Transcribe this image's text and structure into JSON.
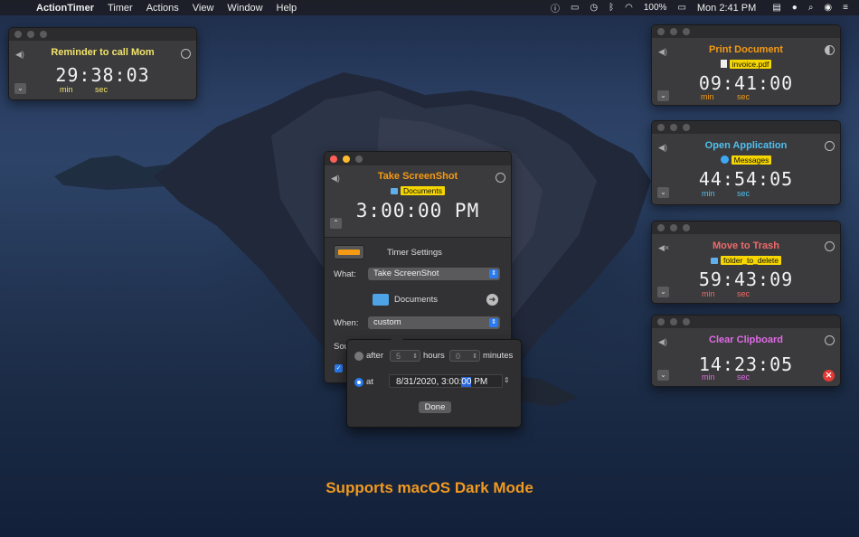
{
  "menubar": {
    "app_name": "ActionTimer",
    "menus": [
      "Timer",
      "Actions",
      "View",
      "Window",
      "Help"
    ],
    "battery": "100%",
    "clock": "Mon 2:41 PM"
  },
  "timers": {
    "reminder": {
      "title": "Reminder to call Mom",
      "time": "29:38:03",
      "unit_min": "min",
      "unit_sec": "sec",
      "title_color": "#f2e36a"
    },
    "print": {
      "title": "Print Document",
      "tag": "invoice.pdf",
      "time": "09:41:00",
      "unit_min": "min",
      "unit_sec": "sec",
      "title_color": "#f59a12"
    },
    "open": {
      "title": "Open Application",
      "tag": "Messages",
      "time": "44:54:05",
      "unit_min": "min",
      "unit_sec": "sec",
      "title_color": "#4fc0f0"
    },
    "trash": {
      "title": "Move to Trash",
      "tag": "folder_to_delete",
      "time": "59:43:09",
      "unit_min": "min",
      "unit_sec": "sec",
      "title_color": "#f06a6a"
    },
    "clipboard": {
      "title": "Clear Clipboard",
      "time": "14:23:05",
      "unit_min": "min",
      "unit_sec": "sec",
      "title_color": "#e06ae6"
    }
  },
  "main": {
    "title": "Take ScreenShot",
    "tag": "Documents",
    "time": "3:00:00 PM",
    "title_color": "#f59a12",
    "settings_label": "Timer Settings",
    "what_label": "What:",
    "what_value": "Take ScreenShot",
    "folder": "Documents",
    "when_label": "When:",
    "when_value": "custom",
    "sound_label_partial": "Sou"
  },
  "popover": {
    "after_label": "after",
    "hours_value": "5",
    "hours_label": "hours",
    "minutes_value": "0",
    "minutes_label": "minutes",
    "at_label": "at",
    "date_prefix": "8/31/2020,   3:00:",
    "date_selected": "00",
    "date_suffix": " PM",
    "done_label": "Done"
  },
  "caption": "Supports macOS Dark Mode",
  "accent": "#2a7bf0"
}
